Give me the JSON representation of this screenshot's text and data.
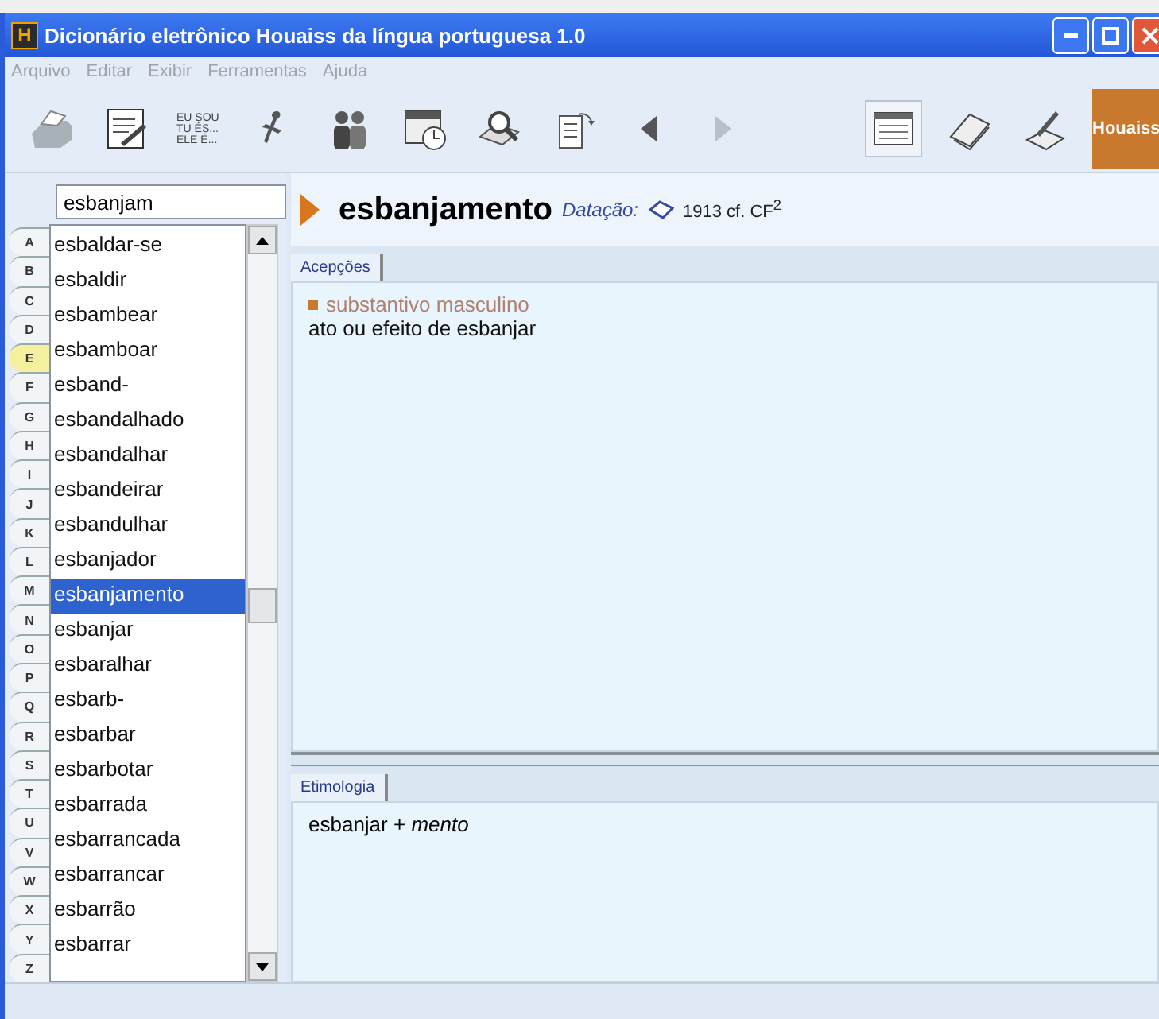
{
  "window": {
    "title": "Dicionário eletrônico Houaiss da língua portuguesa 1.0",
    "logo_letter": "H"
  },
  "menu": [
    "Arquivo",
    "Editar",
    "Exibir",
    "Ferramentas",
    "Ajuda"
  ],
  "toolbar": {
    "tools": [
      {
        "kind": "printer"
      },
      {
        "kind": "notepad"
      },
      {
        "kind": "conjugation",
        "lines": [
          "EU SOU",
          "TU ÉS...",
          "ELE É..."
        ]
      },
      {
        "kind": "figure"
      },
      {
        "kind": "people"
      },
      {
        "kind": "calendar"
      },
      {
        "kind": "search-book"
      },
      {
        "kind": "document"
      }
    ],
    "nav": [
      {
        "kind": "back",
        "disabled": false
      },
      {
        "kind": "forward",
        "disabled": true
      }
    ],
    "views": [
      {
        "kind": "window",
        "selected": true
      },
      {
        "kind": "book",
        "selected": false
      },
      {
        "kind": "book-pen",
        "selected": false
      }
    ],
    "logo": "Houaiss"
  },
  "search": {
    "value": "esbanjam"
  },
  "alphabet": [
    {
      "letter": "A",
      "selected": false
    },
    {
      "letter": "B",
      "selected": false
    },
    {
      "letter": "C",
      "selected": false
    },
    {
      "letter": "D",
      "selected": false
    },
    {
      "letter": "E",
      "selected": true
    },
    {
      "letter": "F",
      "selected": false
    },
    {
      "letter": "G",
      "selected": false
    },
    {
      "letter": "H",
      "selected": false
    },
    {
      "letter": "I",
      "selected": false
    },
    {
      "letter": "J",
      "selected": false
    },
    {
      "letter": "K",
      "selected": false
    },
    {
      "letter": "L",
      "selected": false
    },
    {
      "letter": "M",
      "selected": false
    },
    {
      "letter": "N",
      "selected": false
    },
    {
      "letter": "O",
      "selected": false
    },
    {
      "letter": "P",
      "selected": false
    },
    {
      "letter": "Q",
      "selected": false
    },
    {
      "letter": "R",
      "selected": false
    },
    {
      "letter": "S",
      "selected": false
    },
    {
      "letter": "T",
      "selected": false
    },
    {
      "letter": "U",
      "selected": false
    },
    {
      "letter": "V",
      "selected": false
    },
    {
      "letter": "W",
      "selected": false
    },
    {
      "letter": "X",
      "selected": false
    },
    {
      "letter": "Y",
      "selected": false
    },
    {
      "letter": "Z",
      "selected": false
    }
  ],
  "words": [
    {
      "text": "esbaldar-se",
      "selected": false
    },
    {
      "text": "esbaldir",
      "selected": false
    },
    {
      "text": "esbambear",
      "selected": false
    },
    {
      "text": "esbamboar",
      "selected": false
    },
    {
      "text": "esband-",
      "selected": false
    },
    {
      "text": "esbandalhado",
      "selected": false
    },
    {
      "text": "esbandalhar",
      "selected": false
    },
    {
      "text": "esbandeirar",
      "selected": false
    },
    {
      "text": "esbandulhar",
      "selected": false
    },
    {
      "text": "esbanjador",
      "selected": false
    },
    {
      "text": "esbanjamento",
      "selected": true
    },
    {
      "text": "esbanjar",
      "selected": false
    },
    {
      "text": "esbaralhar",
      "selected": false
    },
    {
      "text": "esbarb-",
      "selected": false
    },
    {
      "text": "esbarbar",
      "selected": false
    },
    {
      "text": "esbarbotar",
      "selected": false
    },
    {
      "text": "esbarrada",
      "selected": false
    },
    {
      "text": "esbarrancada",
      "selected": false
    },
    {
      "text": "esbarrancar",
      "selected": false
    },
    {
      "text": "esbarrão",
      "selected": false
    },
    {
      "text": "esbarrar",
      "selected": false
    }
  ],
  "entry": {
    "headword": "esbanjamento",
    "dating_label": "Datação:",
    "dating": "1913 cf. CF$^{2}$"
  },
  "senses": {
    "tab": "Acepções",
    "class": "substantivo masculino",
    "definition": "ato ou efeito de esbanjar"
  },
  "etymology": {
    "tab": "Etimologia",
    "text": "esbanjar + *mento*"
  }
}
